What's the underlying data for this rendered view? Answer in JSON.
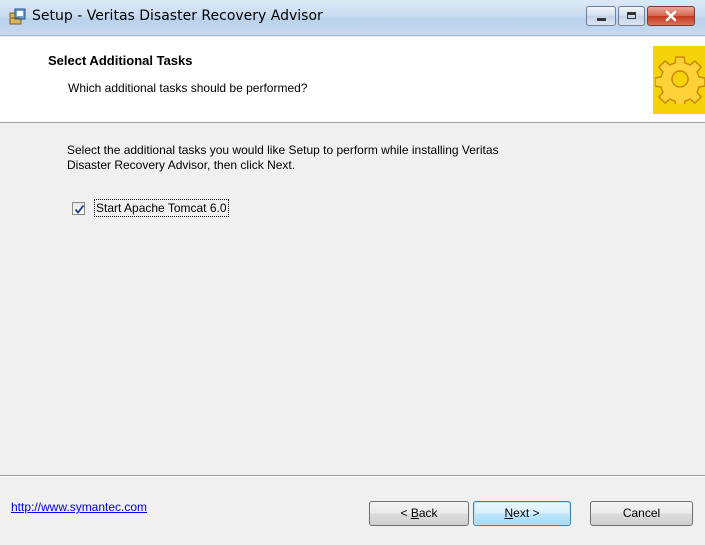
{
  "window": {
    "title": "Setup - Veritas Disaster Recovery Advisor",
    "app_icon": "setup-box-icon",
    "controls": {
      "minimize": "minimize-icon",
      "maximize": "maximize-icon",
      "close": "close-icon"
    }
  },
  "header": {
    "title": "Select Additional Tasks",
    "subtitle": "Which additional tasks should be performed?",
    "image": "gear-icon",
    "image_bg": "#f5d20a"
  },
  "body": {
    "description_line1": "Select the additional tasks you would like Setup to perform while installing Veritas",
    "description_line2": "Disaster Recovery Advisor, then click Next.",
    "tasks": [
      {
        "label": "Start Apache Tomcat 6.0",
        "checked": true
      }
    ]
  },
  "footer": {
    "link": "http://www.symantec.com",
    "back_label": "Back",
    "back_prefix": "< ",
    "next_label": "Next",
    "next_suffix": " >",
    "cancel_label": "Cancel"
  }
}
